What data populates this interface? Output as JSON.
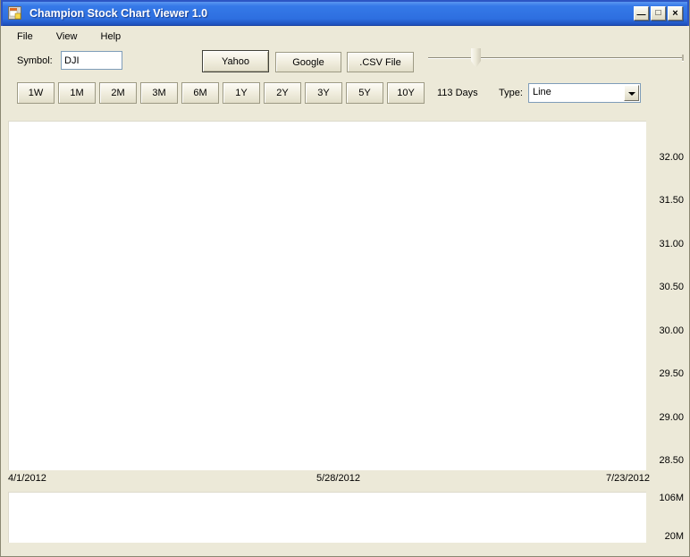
{
  "window": {
    "title": "Champion Stock Chart Viewer 1.0",
    "icons": {
      "minimize": "—",
      "maximize": "□",
      "close": "×"
    }
  },
  "menu": {
    "items": [
      "File",
      "View",
      "Help"
    ]
  },
  "toolbar": {
    "symbol_label": "Symbol:",
    "symbol_value": "DJI",
    "yahoo_label": "Yahoo",
    "google_label": "Google",
    "csv_label": ".CSV File"
  },
  "period_bar": {
    "buttons": [
      "1W",
      "1M",
      "2M",
      "3M",
      "6M",
      "1Y",
      "2Y",
      "3Y",
      "5Y",
      "10Y"
    ],
    "days_label": "113 Days",
    "type_label": "Type:",
    "type_value": "Line"
  },
  "chart_data": {
    "type": "line",
    "symbol": "DJI",
    "chart_type_selected": "Line",
    "days_shown": 113,
    "series": [],
    "price_axis": {
      "position": "right",
      "ticks": [
        "32.00",
        "31.50",
        "31.00",
        "30.50",
        "30.00",
        "29.50",
        "29.00",
        "28.50"
      ],
      "range": [
        28.5,
        32.0
      ]
    },
    "date_axis": {
      "ticks": [
        "4/1/2012",
        "5/28/2012",
        "7/23/2012"
      ],
      "range": [
        "4/1/2012",
        "7/23/2012"
      ]
    },
    "volume_axis": {
      "position": "right",
      "ticks": [
        "106M",
        "20M"
      ]
    },
    "plot_area_empty": true
  },
  "colors": {
    "titlebar_blue": "#2E6FE0",
    "window_bg": "#ECE9D8",
    "chart_bg": "#FFFFFF",
    "text": "#000000"
  }
}
